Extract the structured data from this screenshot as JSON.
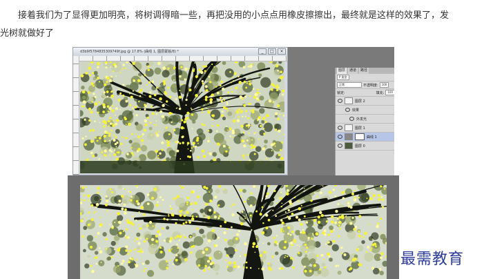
{
  "article": {
    "paragraph_line1": "接着我们为了显得更加明亮，将树调得暗一些，再把没用的小点点用橡皮擦擦出，最终就是这样的效果了，发",
    "paragraph_line2": "光树就做好了"
  },
  "ps_window": {
    "title": "d3b9f5784835309749f.jpg @ 17.8% (曲线 1, 图层蒙版/8) *",
    "buttons": [
      "_",
      "□",
      "×"
    ],
    "panel": {
      "tabs": [
        "图层",
        "通道",
        "路径"
      ],
      "filter_label": "P 类型",
      "blend_mode": "正常",
      "opacity_label": "不透明度:",
      "opacity_value": "100",
      "lock_label": "锁定:",
      "fill_label": "填充:",
      "fill_value": "100",
      "layers": [
        {
          "name": "图层 2"
        },
        {
          "name": "效果"
        },
        {
          "name": "外发光"
        },
        {
          "name": "图层 1"
        },
        {
          "name": "曲线 1"
        },
        {
          "name": "图层 0"
        }
      ]
    }
  },
  "watermark": {
    "text": "最需教育",
    "color": "#2c3c9a"
  }
}
